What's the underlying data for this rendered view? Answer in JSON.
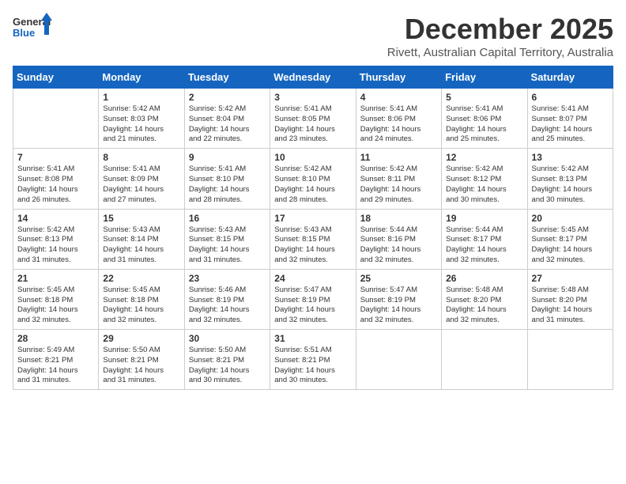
{
  "header": {
    "logo_general": "General",
    "logo_blue": "Blue",
    "month_year": "December 2025",
    "location": "Rivett, Australian Capital Territory, Australia"
  },
  "calendar": {
    "days_of_week": [
      "Sunday",
      "Monday",
      "Tuesday",
      "Wednesday",
      "Thursday",
      "Friday",
      "Saturday"
    ],
    "weeks": [
      [
        {
          "date": "",
          "info": ""
        },
        {
          "date": "1",
          "info": "Sunrise: 5:42 AM\nSunset: 8:03 PM\nDaylight: 14 hours\nand 21 minutes."
        },
        {
          "date": "2",
          "info": "Sunrise: 5:42 AM\nSunset: 8:04 PM\nDaylight: 14 hours\nand 22 minutes."
        },
        {
          "date": "3",
          "info": "Sunrise: 5:41 AM\nSunset: 8:05 PM\nDaylight: 14 hours\nand 23 minutes."
        },
        {
          "date": "4",
          "info": "Sunrise: 5:41 AM\nSunset: 8:06 PM\nDaylight: 14 hours\nand 24 minutes."
        },
        {
          "date": "5",
          "info": "Sunrise: 5:41 AM\nSunset: 8:06 PM\nDaylight: 14 hours\nand 25 minutes."
        },
        {
          "date": "6",
          "info": "Sunrise: 5:41 AM\nSunset: 8:07 PM\nDaylight: 14 hours\nand 25 minutes."
        }
      ],
      [
        {
          "date": "7",
          "info": "Sunrise: 5:41 AM\nSunset: 8:08 PM\nDaylight: 14 hours\nand 26 minutes."
        },
        {
          "date": "8",
          "info": "Sunrise: 5:41 AM\nSunset: 8:09 PM\nDaylight: 14 hours\nand 27 minutes."
        },
        {
          "date": "9",
          "info": "Sunrise: 5:41 AM\nSunset: 8:10 PM\nDaylight: 14 hours\nand 28 minutes."
        },
        {
          "date": "10",
          "info": "Sunrise: 5:42 AM\nSunset: 8:10 PM\nDaylight: 14 hours\nand 28 minutes."
        },
        {
          "date": "11",
          "info": "Sunrise: 5:42 AM\nSunset: 8:11 PM\nDaylight: 14 hours\nand 29 minutes."
        },
        {
          "date": "12",
          "info": "Sunrise: 5:42 AM\nSunset: 8:12 PM\nDaylight: 14 hours\nand 30 minutes."
        },
        {
          "date": "13",
          "info": "Sunrise: 5:42 AM\nSunset: 8:13 PM\nDaylight: 14 hours\nand 30 minutes."
        }
      ],
      [
        {
          "date": "14",
          "info": "Sunrise: 5:42 AM\nSunset: 8:13 PM\nDaylight: 14 hours\nand 31 minutes."
        },
        {
          "date": "15",
          "info": "Sunrise: 5:43 AM\nSunset: 8:14 PM\nDaylight: 14 hours\nand 31 minutes."
        },
        {
          "date": "16",
          "info": "Sunrise: 5:43 AM\nSunset: 8:15 PM\nDaylight: 14 hours\nand 31 minutes."
        },
        {
          "date": "17",
          "info": "Sunrise: 5:43 AM\nSunset: 8:15 PM\nDaylight: 14 hours\nand 32 minutes."
        },
        {
          "date": "18",
          "info": "Sunrise: 5:44 AM\nSunset: 8:16 PM\nDaylight: 14 hours\nand 32 minutes."
        },
        {
          "date": "19",
          "info": "Sunrise: 5:44 AM\nSunset: 8:17 PM\nDaylight: 14 hours\nand 32 minutes."
        },
        {
          "date": "20",
          "info": "Sunrise: 5:45 AM\nSunset: 8:17 PM\nDaylight: 14 hours\nand 32 minutes."
        }
      ],
      [
        {
          "date": "21",
          "info": "Sunrise: 5:45 AM\nSunset: 8:18 PM\nDaylight: 14 hours\nand 32 minutes."
        },
        {
          "date": "22",
          "info": "Sunrise: 5:45 AM\nSunset: 8:18 PM\nDaylight: 14 hours\nand 32 minutes."
        },
        {
          "date": "23",
          "info": "Sunrise: 5:46 AM\nSunset: 8:19 PM\nDaylight: 14 hours\nand 32 minutes."
        },
        {
          "date": "24",
          "info": "Sunrise: 5:47 AM\nSunset: 8:19 PM\nDaylight: 14 hours\nand 32 minutes."
        },
        {
          "date": "25",
          "info": "Sunrise: 5:47 AM\nSunset: 8:19 PM\nDaylight: 14 hours\nand 32 minutes."
        },
        {
          "date": "26",
          "info": "Sunrise: 5:48 AM\nSunset: 8:20 PM\nDaylight: 14 hours\nand 32 minutes."
        },
        {
          "date": "27",
          "info": "Sunrise: 5:48 AM\nSunset: 8:20 PM\nDaylight: 14 hours\nand 31 minutes."
        }
      ],
      [
        {
          "date": "28",
          "info": "Sunrise: 5:49 AM\nSunset: 8:21 PM\nDaylight: 14 hours\nand 31 minutes."
        },
        {
          "date": "29",
          "info": "Sunrise: 5:50 AM\nSunset: 8:21 PM\nDaylight: 14 hours\nand 31 minutes."
        },
        {
          "date": "30",
          "info": "Sunrise: 5:50 AM\nSunset: 8:21 PM\nDaylight: 14 hours\nand 30 minutes."
        },
        {
          "date": "31",
          "info": "Sunrise: 5:51 AM\nSunset: 8:21 PM\nDaylight: 14 hours\nand 30 minutes."
        },
        {
          "date": "",
          "info": ""
        },
        {
          "date": "",
          "info": ""
        },
        {
          "date": "",
          "info": ""
        }
      ]
    ]
  }
}
